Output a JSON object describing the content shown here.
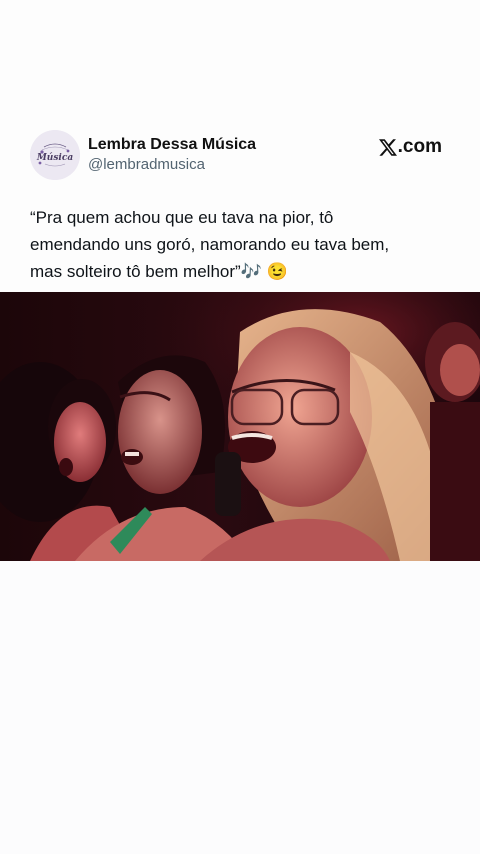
{
  "author": {
    "display_name": "Lembra Dessa Música",
    "handle": "@lembradmusica",
    "avatar_text": "Música"
  },
  "brand": {
    "label": ".com",
    "icon": "x-logo-icon"
  },
  "tweet": {
    "text": "“Pra quem achou que eu tava na pior, tô\nemendando uns goró, namorando eu tava bem,\nmas solteiro tô bem melhor”🎶 😉"
  },
  "media": {
    "icon": "concert-photo"
  },
  "colors": {
    "text_primary": "#0f1419",
    "text_secondary": "#536471",
    "background": "#fdfdfd"
  }
}
